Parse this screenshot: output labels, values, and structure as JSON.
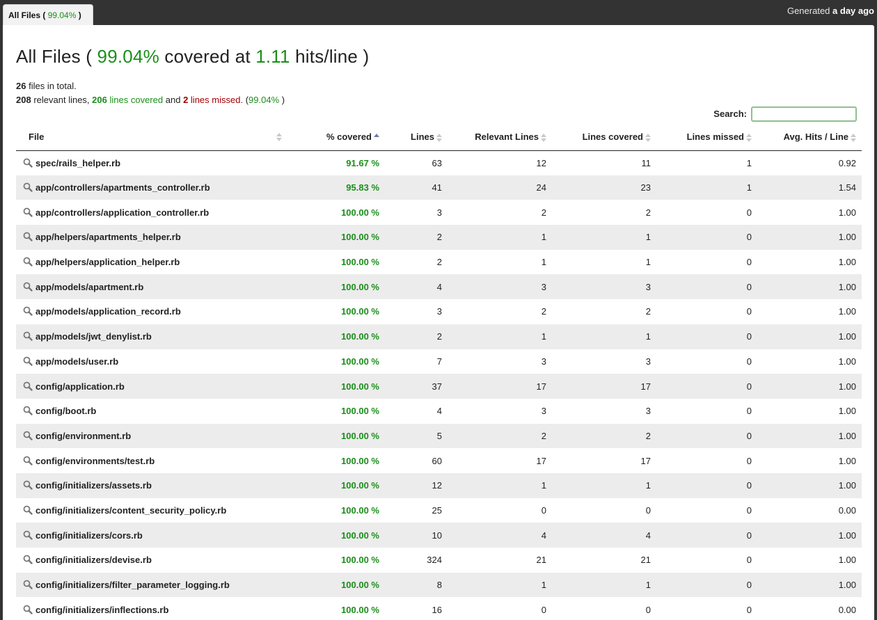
{
  "tab": {
    "label": "All Files",
    "pct": "99.04%"
  },
  "generated": {
    "prefix": "Generated",
    "when": "a day ago"
  },
  "title": {
    "prefix": "All Files (",
    "pct": "99.04%",
    "mid": "covered at",
    "hits": "1.11",
    "suffix": "hits/line )"
  },
  "summary": {
    "files_count": "26",
    "files_text": "files in total.",
    "relevant": "208",
    "relevant_text": "relevant lines,",
    "covered": "206",
    "covered_text": "lines covered",
    "and_text": "and",
    "missed": "2",
    "missed_text": "lines missed.",
    "pct": "99.04%"
  },
  "search": {
    "label": "Search:",
    "value": ""
  },
  "table": {
    "headers": [
      "File",
      "% covered",
      "Lines",
      "Relevant Lines",
      "Lines covered",
      "Lines missed",
      "Avg. Hits / Line"
    ],
    "rows": [
      [
        "spec/rails_helper.rb",
        "91.67 %",
        "63",
        "12",
        "11",
        "1",
        "0.92"
      ],
      [
        "app/controllers/apartments_controller.rb",
        "95.83 %",
        "41",
        "24",
        "23",
        "1",
        "1.54"
      ],
      [
        "app/controllers/application_controller.rb",
        "100.00 %",
        "3",
        "2",
        "2",
        "0",
        "1.00"
      ],
      [
        "app/helpers/apartments_helper.rb",
        "100.00 %",
        "2",
        "1",
        "1",
        "0",
        "1.00"
      ],
      [
        "app/helpers/application_helper.rb",
        "100.00 %",
        "2",
        "1",
        "1",
        "0",
        "1.00"
      ],
      [
        "app/models/apartment.rb",
        "100.00 %",
        "4",
        "3",
        "3",
        "0",
        "1.00"
      ],
      [
        "app/models/application_record.rb",
        "100.00 %",
        "3",
        "2",
        "2",
        "0",
        "1.00"
      ],
      [
        "app/models/jwt_denylist.rb",
        "100.00 %",
        "2",
        "1",
        "1",
        "0",
        "1.00"
      ],
      [
        "app/models/user.rb",
        "100.00 %",
        "7",
        "3",
        "3",
        "0",
        "1.00"
      ],
      [
        "config/application.rb",
        "100.00 %",
        "37",
        "17",
        "17",
        "0",
        "1.00"
      ],
      [
        "config/boot.rb",
        "100.00 %",
        "4",
        "3",
        "3",
        "0",
        "1.00"
      ],
      [
        "config/environment.rb",
        "100.00 %",
        "5",
        "2",
        "2",
        "0",
        "1.00"
      ],
      [
        "config/environments/test.rb",
        "100.00 %",
        "60",
        "17",
        "17",
        "0",
        "1.00"
      ],
      [
        "config/initializers/assets.rb",
        "100.00 %",
        "12",
        "1",
        "1",
        "0",
        "1.00"
      ],
      [
        "config/initializers/content_security_policy.rb",
        "100.00 %",
        "25",
        "0",
        "0",
        "0",
        "0.00"
      ],
      [
        "config/initializers/cors.rb",
        "100.00 %",
        "10",
        "4",
        "4",
        "0",
        "1.00"
      ],
      [
        "config/initializers/devise.rb",
        "100.00 %",
        "324",
        "21",
        "21",
        "0",
        "1.00"
      ],
      [
        "config/initializers/filter_parameter_logging.rb",
        "100.00 %",
        "8",
        "1",
        "1",
        "0",
        "1.00"
      ],
      [
        "config/initializers/inflections.rb",
        "100.00 %",
        "16",
        "0",
        "0",
        "0",
        "0.00"
      ]
    ]
  },
  "colors": {
    "green": "#1a8f1a",
    "red": "#a30000",
    "topbar": "#333333"
  }
}
